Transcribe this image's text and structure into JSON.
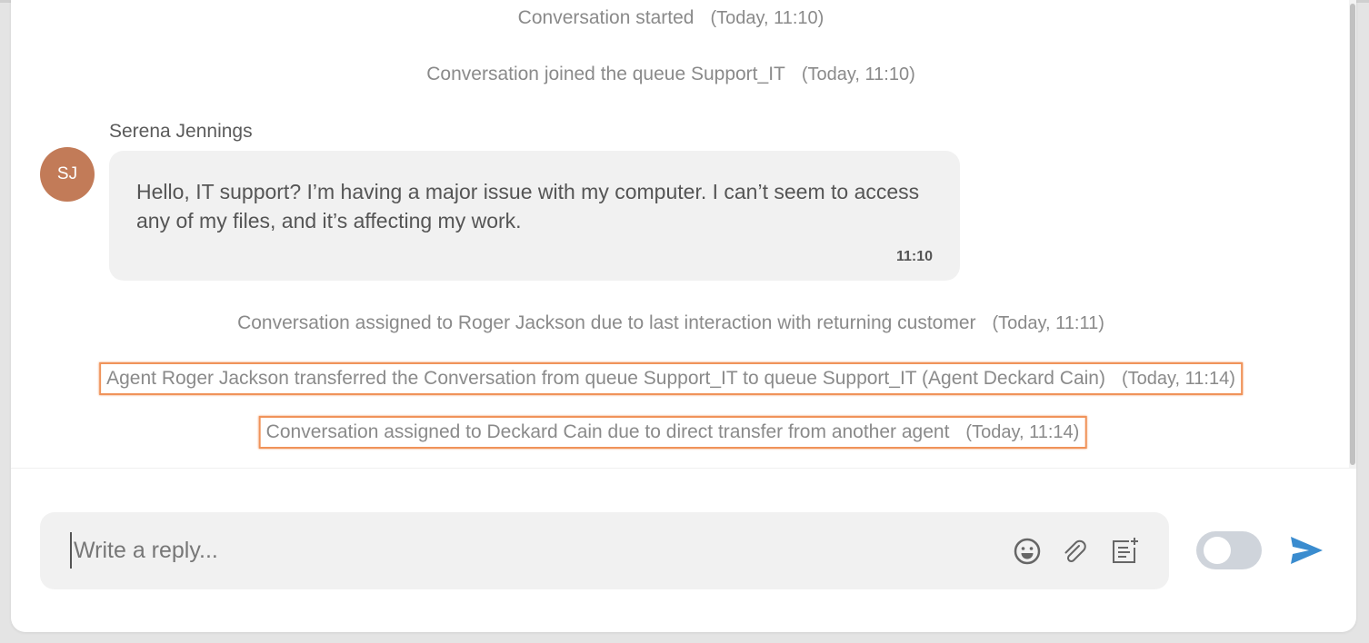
{
  "events": [
    {
      "text": "Conversation started",
      "time": "(Today, 11:10)"
    },
    {
      "text": "Conversation joined the queue Support_IT",
      "time": "(Today, 11:10)"
    },
    {
      "text": "Conversation assigned to Roger Jackson due to last interaction with returning customer",
      "time": "(Today, 11:11)"
    },
    {
      "text": "Agent Roger Jackson transferred the Conversation from queue Support_IT to queue Support_IT (Agent Deckard Cain)",
      "time": "(Today, 11:14)"
    },
    {
      "text": "Conversation assigned to Deckard Cain due to direct transfer from another agent",
      "time": "(Today, 11:14)"
    }
  ],
  "message": {
    "sender": "Serena Jennings",
    "initials": "SJ",
    "avatar_color": "#c27b58",
    "text": "Hello, IT support? I’m having a major issue with my computer. I can’t seem to access any of my files, and it’s affecting my work.",
    "time": "11:10"
  },
  "composer": {
    "placeholder": "Write a reply...",
    "value": "",
    "toggle_on": false,
    "send_color": "#3a8ccf"
  },
  "highlight_color": "#f0935a"
}
